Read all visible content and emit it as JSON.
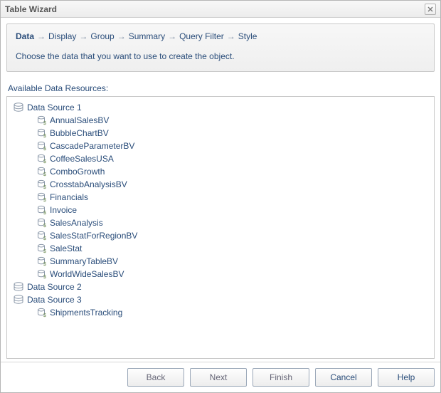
{
  "window": {
    "title": "Table Wizard"
  },
  "breadcrumb": {
    "steps": [
      "Data",
      "Display",
      "Group",
      "Summary",
      "Query Filter",
      "Style"
    ],
    "active_index": 0
  },
  "instruction": "Choose the data that you want to use to create the object.",
  "available_label": "Available Data Resources:",
  "data_sources": [
    {
      "name": "Data Source 1",
      "items": [
        "AnnualSalesBV",
        "BubbleChartBV",
        "CascadeParameterBV",
        "CoffeeSalesUSA",
        "ComboGrowth",
        "CrosstabAnalysisBV",
        "Financials",
        "Invoice",
        "SalesAnalysis",
        "SalesStatForRegionBV",
        "SaleStat",
        "SummaryTableBV",
        "WorldWideSalesBV"
      ]
    },
    {
      "name": "Data Source 2",
      "items": []
    },
    {
      "name": "Data Source 3",
      "items": [
        "ShipmentsTracking"
      ]
    }
  ],
  "buttons": {
    "back": "Back",
    "next": "Next",
    "finish": "Finish",
    "cancel": "Cancel",
    "help": "Help"
  }
}
